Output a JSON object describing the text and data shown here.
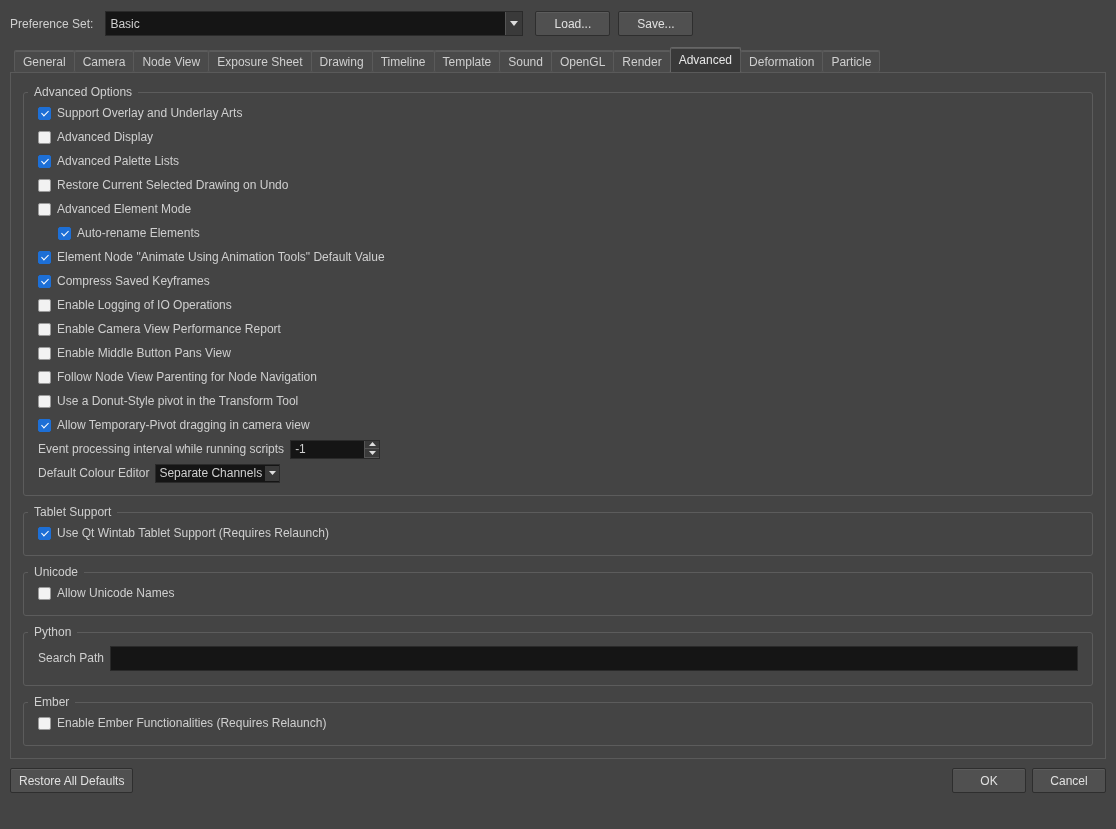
{
  "preference_set": {
    "label": "Preference Set:",
    "value": "Basic"
  },
  "top_buttons": [
    "Load...",
    "Save..."
  ],
  "tabs": [
    {
      "label": "General",
      "selected": false
    },
    {
      "label": "Camera",
      "selected": false
    },
    {
      "label": "Node View",
      "selected": false
    },
    {
      "label": "Exposure Sheet",
      "selected": false
    },
    {
      "label": "Drawing",
      "selected": false
    },
    {
      "label": "Timeline",
      "selected": false
    },
    {
      "label": "Template",
      "selected": false
    },
    {
      "label": "Sound",
      "selected": false
    },
    {
      "label": "OpenGL",
      "selected": false
    },
    {
      "label": "Render",
      "selected": false
    },
    {
      "label": "Advanced",
      "selected": true
    },
    {
      "label": "Deformation",
      "selected": false
    },
    {
      "label": "Particle",
      "selected": false
    }
  ],
  "groups": [
    {
      "title": "Advanced Options",
      "items": [
        {
          "kind": "checkbox",
          "label": "Support Overlay and Underlay Arts",
          "checked": true
        },
        {
          "kind": "checkbox",
          "label": "Advanced Display",
          "checked": false
        },
        {
          "kind": "checkbox",
          "label": "Advanced Palette Lists",
          "checked": true
        },
        {
          "kind": "checkbox",
          "label": "Restore Current Selected Drawing on Undo",
          "checked": false
        },
        {
          "kind": "checkbox",
          "label": "Advanced Element Mode",
          "checked": false,
          "children": [
            {
              "kind": "checkbox",
              "label": "Auto-rename Elements",
              "checked": true
            }
          ]
        },
        {
          "kind": "checkbox",
          "label": "Element Node \"Animate Using Animation Tools\" Default Value",
          "checked": true
        },
        {
          "kind": "checkbox",
          "label": "Compress Saved Keyframes",
          "checked": true
        },
        {
          "kind": "checkbox",
          "label": "Enable Logging of IO Operations",
          "checked": false
        },
        {
          "kind": "checkbox",
          "label": "Enable Camera View Performance Report",
          "checked": false
        },
        {
          "kind": "checkbox",
          "label": "Enable Middle Button Pans View",
          "checked": false
        },
        {
          "kind": "checkbox",
          "label": "Follow Node View Parenting for Node Navigation",
          "checked": false
        },
        {
          "kind": "checkbox",
          "label": "Use a Donut-Style pivot in the Transform Tool",
          "checked": false
        },
        {
          "kind": "checkbox",
          "label": "Allow Temporary-Pivot dragging in camera view",
          "checked": true
        },
        {
          "kind": "spinbox",
          "label": "Event processing interval while running scripts",
          "value": "-1"
        },
        {
          "kind": "dropdown",
          "label": "Default Colour Editor",
          "value": "Separate Channels"
        }
      ]
    },
    {
      "title": "Tablet Support",
      "items": [
        {
          "kind": "checkbox",
          "label": "Use Qt Wintab Tablet Support (Requires Relaunch)",
          "checked": true
        }
      ]
    },
    {
      "title": "Unicode",
      "items": [
        {
          "kind": "checkbox",
          "label": "Allow Unicode Names",
          "checked": false
        }
      ]
    },
    {
      "title": "Python",
      "items": [
        {
          "kind": "field",
          "label": "Search Path"
        }
      ]
    },
    {
      "title": "Ember",
      "items": [
        {
          "kind": "checkbox",
          "label": "Enable Ember Functionalities (Requires Relaunch)",
          "checked": false
        }
      ]
    }
  ],
  "restore_button": "Restore All Defaults",
  "bottom_buttons": [
    "OK",
    "Cancel"
  ]
}
